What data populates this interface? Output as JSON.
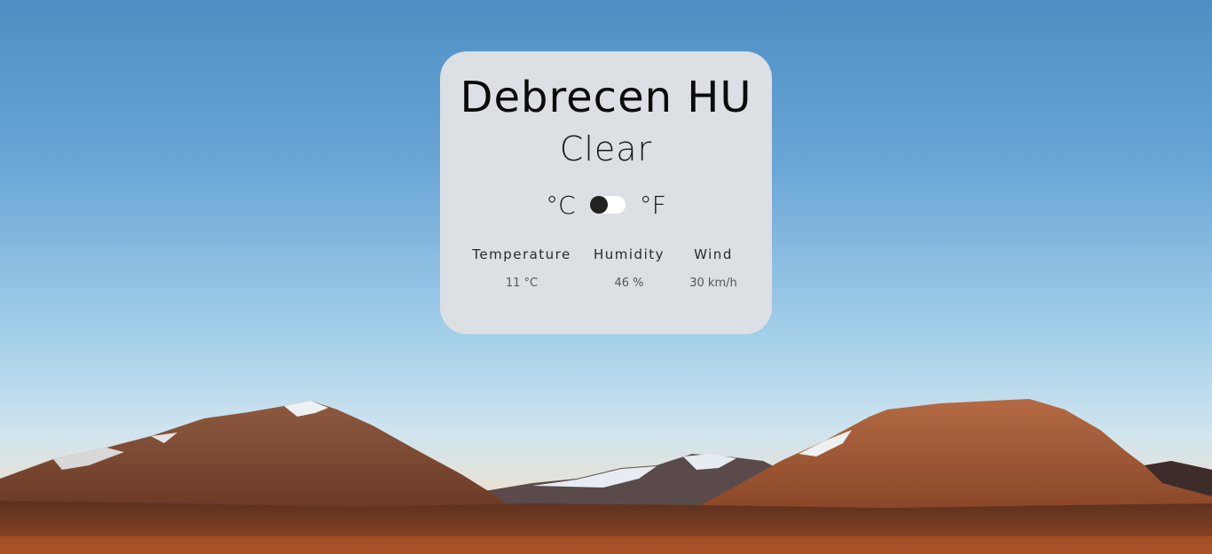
{
  "weather": {
    "city": "Debrecen HU",
    "condition": "Clear",
    "unit_celsius": "°C",
    "unit_fahrenheit": "°F",
    "unit_toggle_state": "celsius",
    "stats": [
      {
        "label": "Temperature",
        "value": "11 °C"
      },
      {
        "label": "Humidity",
        "value": "46 %"
      },
      {
        "label": "Wind",
        "value": "30 km/h"
      }
    ]
  },
  "colors": {
    "card_background": "#dcdfe4",
    "sky_top": "#4d8fc4",
    "sky_horizon": "#cfe4ef",
    "mountain": "#a85a34"
  },
  "icons": [
    "toggle-switch"
  ]
}
